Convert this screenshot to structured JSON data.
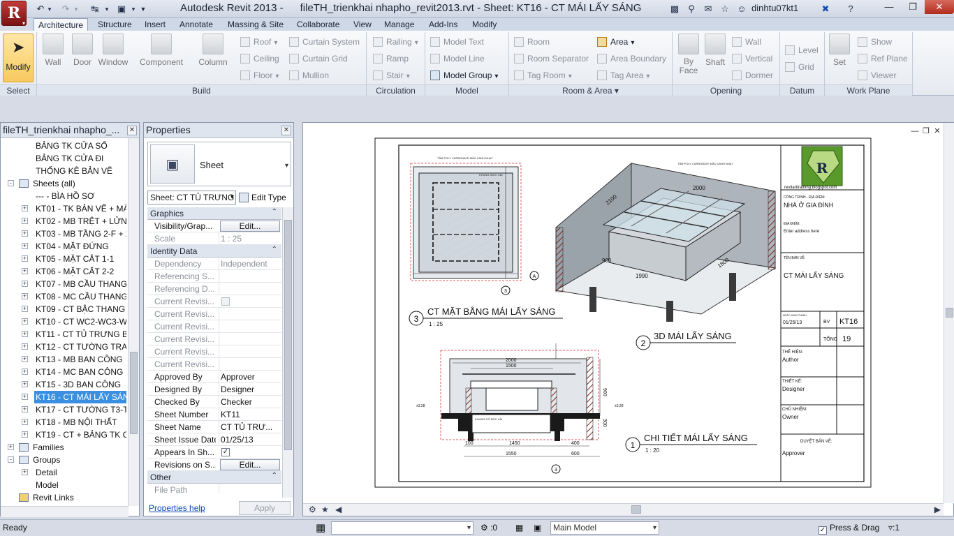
{
  "app": {
    "title_app": "Autodesk Revit 2013 -",
    "title_doc": "fileTH_trienkhai nhapho_revit2013.rvt - Sheet: KT16 - CT MÁI LẤY SÁNG",
    "user": "dinhtu07kt1",
    "logo_letter": "R"
  },
  "ribbon": {
    "tabs": [
      "Architecture",
      "Structure",
      "Insert",
      "Annotate",
      "Massing & Site",
      "Collaborate",
      "View",
      "Manage",
      "Add-Ins",
      "Modify"
    ],
    "modify_label": "Modify",
    "build_big": [
      "Wall",
      "Door",
      "Window",
      "Component",
      "Column"
    ],
    "build_small": [
      "Roof",
      "Ceiling",
      "Floor",
      "Curtain System",
      "Curtain Grid",
      "Mullion"
    ],
    "circulation": [
      "Railing",
      "Ramp",
      "Stair"
    ],
    "model": [
      "Model Text",
      "Model Line",
      "Model Group"
    ],
    "room_area": [
      "Room",
      "Room Separator",
      "Tag Room",
      "Area",
      "Area Boundary",
      "Tag Area"
    ],
    "opening": [
      "By Face",
      "Shaft",
      "Wall",
      "Vertical",
      "Dormer"
    ],
    "datum": [
      "Level",
      "Grid"
    ],
    "work_plane": [
      "Set",
      "Show",
      "Ref Plane",
      "Viewer"
    ],
    "panels": [
      "Select",
      "Build",
      "Circulation",
      "Model",
      "Room & Area",
      "Opening",
      "Datum",
      "Work Plane"
    ]
  },
  "browser": {
    "title": "fileTH_trienkhai nhapho_...",
    "items": [
      "BẢNG TK CỬA SỔ",
      "BẢNG TK CỬA ĐI",
      "THỐNG KÊ BẢN VẼ",
      "Sheets (all)",
      "--- - BÌA HỒ SƠ",
      "KT01 - TK BẢN VẼ + MÀ",
      "KT02 - MB TRỆT + LỬNG",
      "KT03 - MB TẦNG 2-F + 2",
      "KT04 - MẶT ĐỨNG",
      "KT05 - MẶT CẮT 1-1",
      "KT06 - MẶT CẮT 2-2",
      "KT07 - MB CẦU THANG",
      "KT08 - MC CẦU THANG",
      "KT09 - CT BẬC THANG +",
      "KT10 - CT WC2-WC3-WC",
      "KT11 - CT TỦ TRƯNG BÀ",
      "KT12 - CT TƯỜNG TRAN",
      "KT13 - MB BAN CÔNG",
      "KT14 - MC BAN CÔNG",
      "KT15 - 3D BAN CÔNG",
      "KT16 - CT MÁI LẤY SÁNG",
      "KT17 - CT TƯỜNG T3-T",
      "KT18 - MB NỘI THẤT",
      "KT19 - CT + BẢNG TK CỬ",
      "Families",
      "Groups",
      "Detail",
      "Model",
      "Revit Links"
    ]
  },
  "properties": {
    "title": "Properties",
    "type_name": "Sheet",
    "instance_selector": "Sheet: CT TỦ TRƯNG",
    "edit_type": "Edit Type",
    "help": "Properties help",
    "apply": "Apply",
    "rows": [
      {
        "k": "Graphics"
      },
      {
        "k": "Visibility/Grap...",
        "v": "Edit..."
      },
      {
        "k": "Scale",
        "v": "1 : 25"
      },
      {
        "k": "Identity Data"
      },
      {
        "k": "Dependency",
        "v": "Independent"
      },
      {
        "k": "Referencing S..."
      },
      {
        "k": "Referencing D..."
      },
      {
        "k": "Current Revisi..."
      },
      {
        "k": "Current Revisi..."
      },
      {
        "k": "Current Revisi..."
      },
      {
        "k": "Current Revisi..."
      },
      {
        "k": "Current Revisi..."
      },
      {
        "k": "Current Revisi..."
      },
      {
        "k": "Approved By",
        "v": "Approver"
      },
      {
        "k": "Designed By",
        "v": "Designer"
      },
      {
        "k": "Checked By",
        "v": "Checker"
      },
      {
        "k": "Sheet Number",
        "v": "KT11"
      },
      {
        "k": "Sheet Name",
        "v": "CT TỦ TRƯ..."
      },
      {
        "k": "Sheet Issue Date",
        "v": "01/25/13"
      },
      {
        "k": "Appears In Sh..."
      },
      {
        "k": "Revisions on S...",
        "v": "Edit..."
      },
      {
        "k": "Other"
      },
      {
        "k": "File Path"
      }
    ]
  },
  "sheet": {
    "views": [
      {
        "num": "3",
        "title": "CT MẶT BẰNG MÁI LẤY SÁNG",
        "scale": "1 : 25"
      },
      {
        "num": "2",
        "title": "3D MÁI LẤY SÁNG"
      },
      {
        "num": "1",
        "title": "CHI TIẾT MÁI LẤY SÁNG",
        "scale": "1 : 20"
      }
    ],
    "title_block": {
      "site": "revitarttraining.blogspot.com",
      "project_label": "CÔNG TRÌNH - ĐỊA ĐIỂM:",
      "project_value": "NHÀ Ở GIA ĐÌNH",
      "address_label": "ĐỊA ĐIỂM:",
      "address_value": "Enter address here",
      "sheet_name_label": "TÊN BẢN VẼ:",
      "sheet_name_value": "CT MÁI LẤY SÁNG",
      "date_label": "NGÀY HOÀN THÀNH",
      "date_value": "01/25/13",
      "bv_label": "BV",
      "sheet_number": "KT16",
      "total_label": "TỔNG",
      "total_value": "19",
      "author_label": "THỂ HIỆN:",
      "author_value": "Author",
      "designer_label": "THIẾT KẾ:",
      "designer_value": "Designer",
      "checker_label": "CHỦ NHIỆM:",
      "checker_value": "Owner",
      "approver_label": "DUYỆT BẢN VẼ:",
      "approver_value": "Approver"
    },
    "dims": {
      "iso_top": "2000",
      "iso_side": "2100",
      "iso_900": "900",
      "iso_1990": "1990",
      "iso_1800": "1800",
      "det_2000": "2000",
      "det_1500": "1500",
      "det_1450": "1450",
      "det_1550": "1550",
      "det_400": "400",
      "det_600": "600",
      "det_100": "100",
      "det_300": "300",
      "det_900": "900",
      "level": "±3.28",
      "note1": "TẤM POLY CARBONATE MẦU XANH NHẠT",
      "note2": "KHUNG INOX V36",
      "note3": "KHUNG GỖ BỌC VẢI"
    },
    "grid_label": "A"
  },
  "status": {
    "ready": "Ready",
    "count": ":0",
    "workset": "Main Model",
    "press_drag": "Press & Drag",
    "filter": ":1"
  }
}
